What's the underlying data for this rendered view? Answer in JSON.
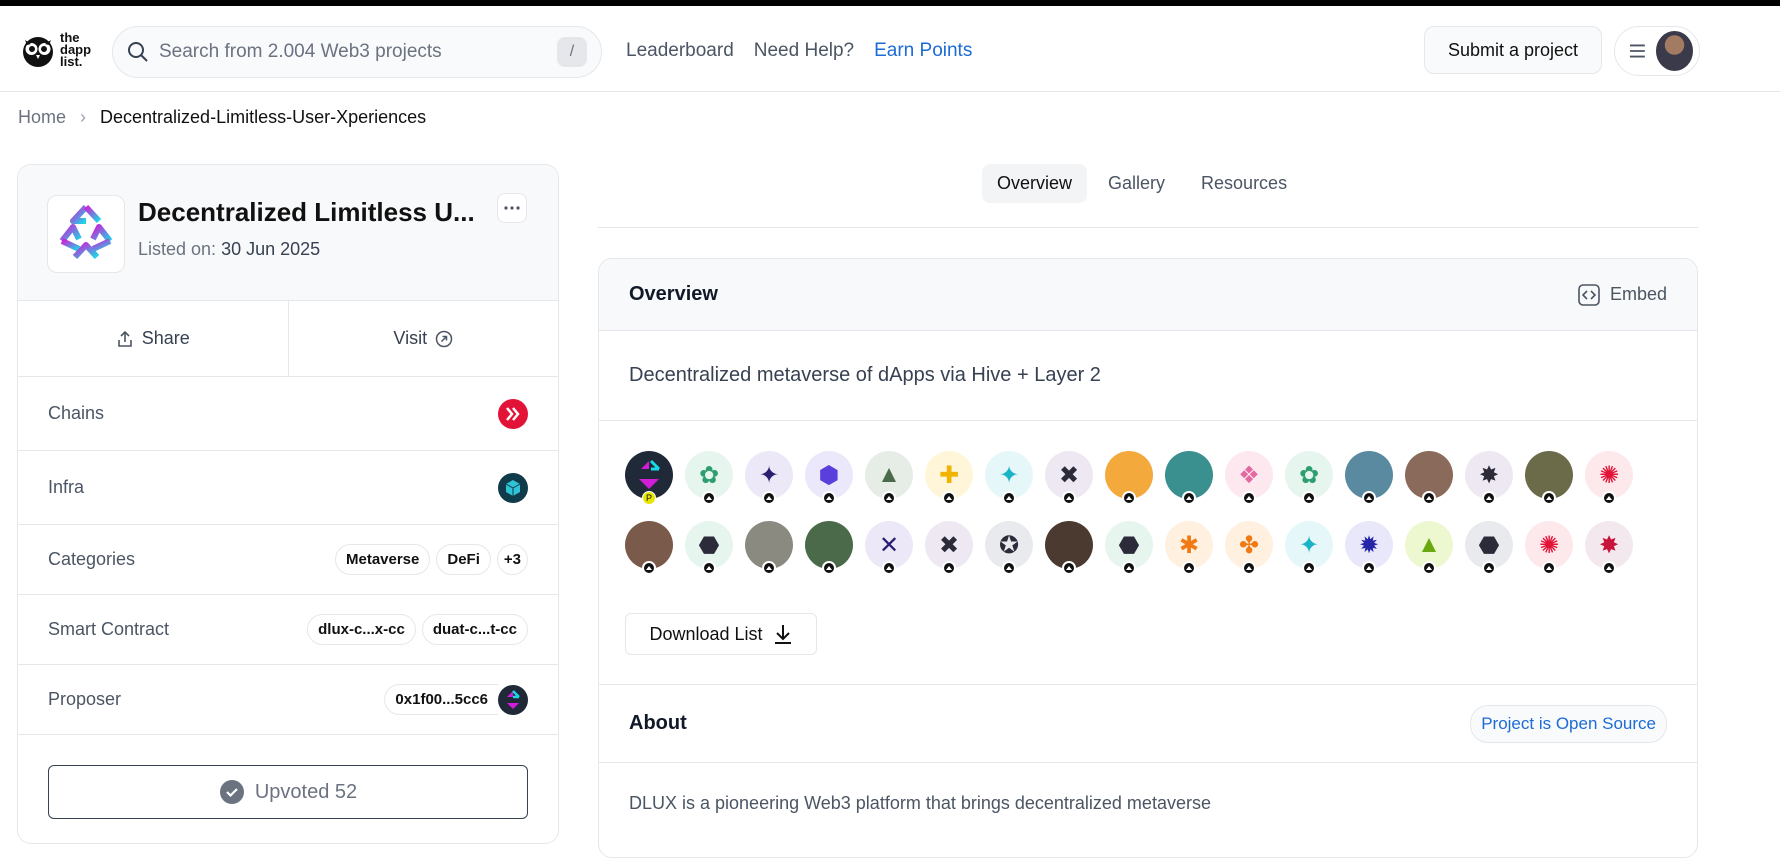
{
  "brand": {
    "name_lines": [
      "the",
      "dapp",
      "list."
    ]
  },
  "search": {
    "placeholder": "Search from 2.004 Web3 projects",
    "shortcut": "/"
  },
  "nav": {
    "leaderboard": "Leaderboard",
    "help": "Need Help?",
    "earn": "Earn Points"
  },
  "header": {
    "submit": "Submit a project"
  },
  "breadcrumb": {
    "home": "Home",
    "current": "Decentralized-Limitless-User-Xperiences"
  },
  "project": {
    "title": "Decentralized Limitless U...",
    "listed_label": "Listed on:",
    "listed_date": "30 Jun 2025",
    "share": "Share",
    "visit": "Visit",
    "rows": {
      "chains": "Chains",
      "infra": "Infra",
      "categories": "Categories",
      "smart_contract": "Smart Contract",
      "proposer": "Proposer"
    },
    "categories": [
      "Metaverse",
      "DeFi",
      "+3"
    ],
    "contracts": [
      "dlux-c...x-cc",
      "duat-c...t-cc"
    ],
    "proposer_address": "0x1f00...5cc6",
    "upvoted": "Upvoted 52"
  },
  "tabs": [
    "Overview",
    "Gallery",
    "Resources"
  ],
  "overview": {
    "title": "Overview",
    "embed": "Embed",
    "description": "Decentralized metaverse of dApps via Hive + Layer 2",
    "download": "Download List"
  },
  "about": {
    "title": "About",
    "open_source": "Project is Open Source",
    "text": "DLUX is a pioneering Web3 platform that brings decentralized metaverse"
  },
  "colors": {
    "accent": "#1d6bd6",
    "chain_badge": "#e31337",
    "infra_badge": "#1a6b80"
  }
}
